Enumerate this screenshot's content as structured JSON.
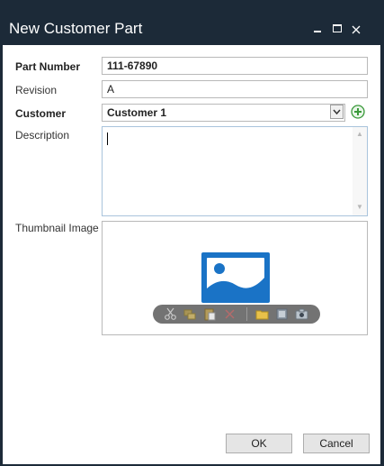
{
  "window": {
    "title": "New Customer Part"
  },
  "form": {
    "part_number": {
      "label": "Part Number",
      "value": "111-67890"
    },
    "revision": {
      "label": "Revision",
      "value": "A"
    },
    "customer": {
      "label": "Customer",
      "value": "Customer 1"
    },
    "description": {
      "label": "Description",
      "value": ""
    },
    "thumbnail": {
      "label": "Thumbnail Image"
    }
  },
  "thumbnail_toolbar": {
    "icons": [
      "cut-icon",
      "copy-icon",
      "paste-icon",
      "delete-icon",
      "open-folder-icon",
      "scan-icon",
      "camera-icon"
    ]
  },
  "footer": {
    "ok_label": "OK",
    "cancel_label": "Cancel"
  },
  "colors": {
    "titlebar": "#1c2a38",
    "image_icon_blue": "#1a73c6",
    "add_green": "#3b9a3b"
  }
}
